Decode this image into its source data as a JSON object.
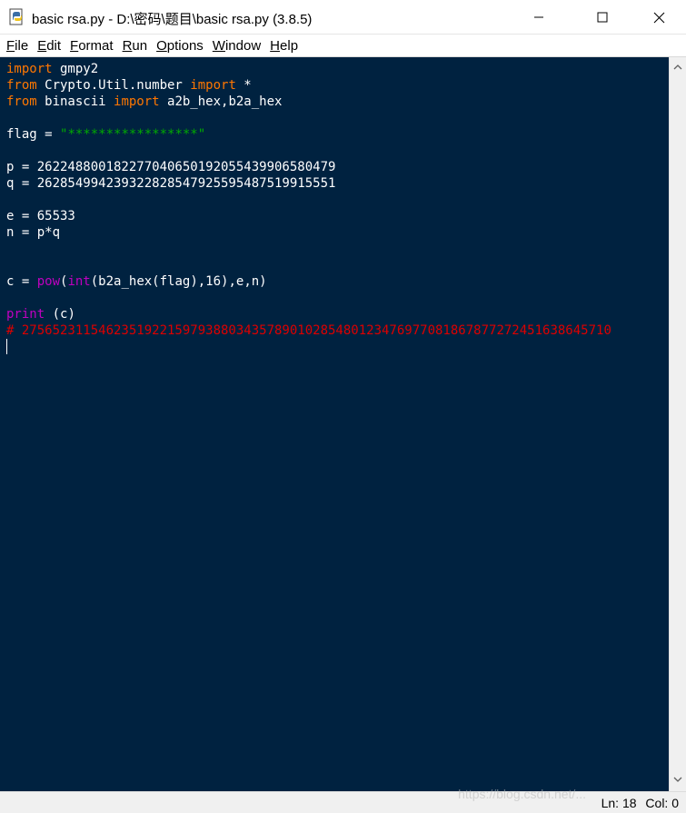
{
  "window": {
    "title": "basic rsa.py - D:\\密码\\题目\\basic rsa.py (3.8.5)"
  },
  "menu": [
    {
      "label": "File",
      "mnemonic": "F",
      "rest": "ile"
    },
    {
      "label": "Edit",
      "mnemonic": "E",
      "rest": "dit"
    },
    {
      "label": "Format",
      "mnemonic": "F",
      "rest": "ormat"
    },
    {
      "label": "Run",
      "mnemonic": "R",
      "rest": "un"
    },
    {
      "label": "Options",
      "mnemonic": "O",
      "rest": "ptions"
    },
    {
      "label": "Window",
      "mnemonic": "W",
      "rest": "indow"
    },
    {
      "label": "Help",
      "mnemonic": "H",
      "rest": "elp"
    }
  ],
  "code_lines": [
    [
      {
        "t": "import",
        "c": "kw"
      },
      {
        "t": " gmpy2",
        "c": ""
      }
    ],
    [
      {
        "t": "from",
        "c": "kw"
      },
      {
        "t": " Crypto.Util.number ",
        "c": ""
      },
      {
        "t": "import",
        "c": "kw"
      },
      {
        "t": " *",
        "c": ""
      }
    ],
    [
      {
        "t": "from",
        "c": "kw"
      },
      {
        "t": " binascii ",
        "c": ""
      },
      {
        "t": "import",
        "c": "kw"
      },
      {
        "t": " a2b_hex,b2a_hex",
        "c": ""
      }
    ],
    [],
    [
      {
        "t": "flag = ",
        "c": ""
      },
      {
        "t": "\"*****************\"",
        "c": "str"
      }
    ],
    [],
    [
      {
        "t": "p = 262248800182277040650192055439906580479",
        "c": ""
      }
    ],
    [
      {
        "t": "q = 262854994239322828547925595487519915551",
        "c": ""
      }
    ],
    [],
    [
      {
        "t": "e = 65533",
        "c": ""
      }
    ],
    [
      {
        "t": "n = p*q",
        "c": ""
      }
    ],
    [],
    [],
    [
      {
        "t": "c = ",
        "c": ""
      },
      {
        "t": "pow",
        "c": "bi"
      },
      {
        "t": "(",
        "c": ""
      },
      {
        "t": "int",
        "c": "bi"
      },
      {
        "t": "(b2a_hex(flag),16),e,n)",
        "c": ""
      }
    ],
    [],
    [
      {
        "t": "print",
        "c": "bi"
      },
      {
        "t": " (c)",
        "c": ""
      }
    ],
    [
      {
        "t": "# 27565231154623519221597938803435789010285480123476977081867877272451638645710",
        "c": "cm"
      }
    ],
    []
  ],
  "status": {
    "line": "Ln: 18",
    "col": "Col: 0"
  },
  "watermark": "https://blog.csdn.net/..."
}
